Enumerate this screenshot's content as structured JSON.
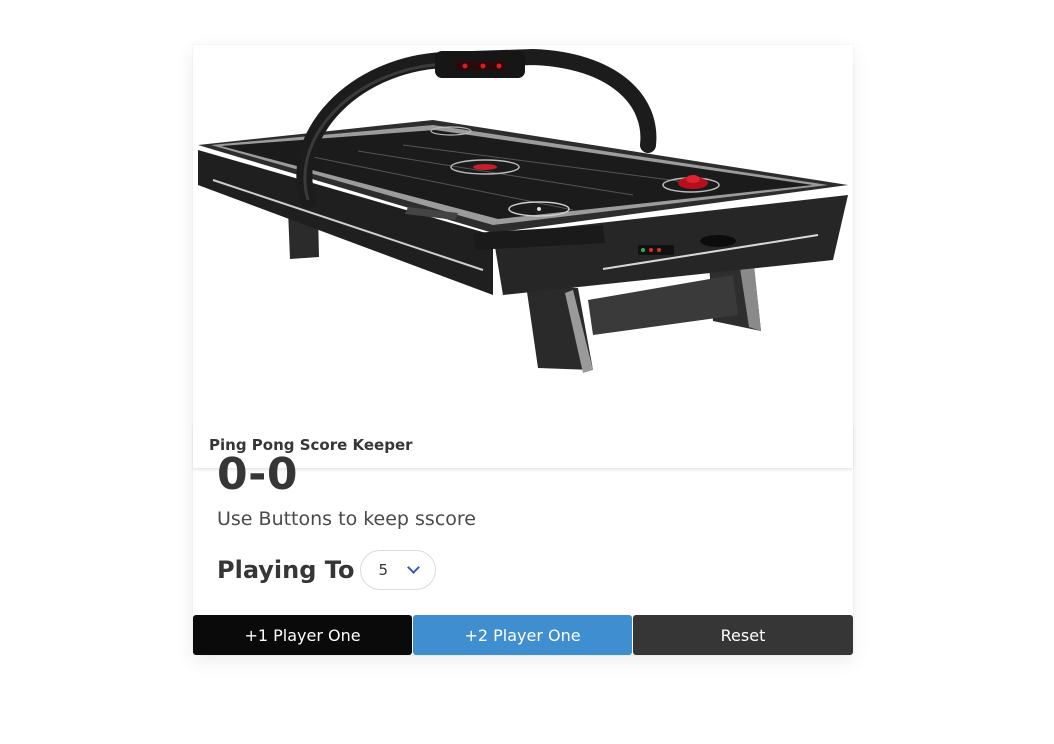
{
  "card": {
    "title": "Ping Pong Score Keeper",
    "image_alt": "air-hockey-table-image"
  },
  "score": "0-0",
  "subtitle": "Use Buttons to keep sscore",
  "playing_to": {
    "label": "Playing To",
    "selected": "5"
  },
  "buttons": {
    "player_one": "+1 Player One",
    "player_two": "+2 Player One",
    "reset": "Reset"
  },
  "colors": {
    "player_one_button": "#0a0a0a",
    "player_two_button": "#3e8ed0",
    "reset_button": "#363636",
    "chevron": "#3e56c4"
  }
}
